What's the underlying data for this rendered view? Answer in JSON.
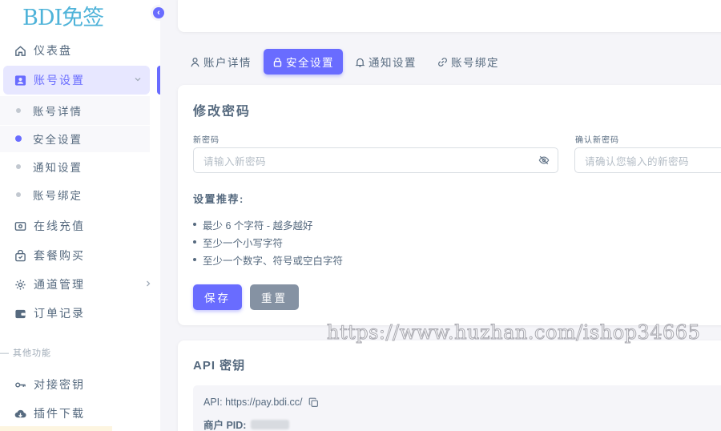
{
  "logo": "BDI免签",
  "sidebar": {
    "items": [
      {
        "label": "仪表盘",
        "icon": "home-icon"
      },
      {
        "label": "账号设置",
        "icon": "account-icon"
      },
      {
        "label": "在线充值",
        "icon": "recharge-icon"
      },
      {
        "label": "套餐购买",
        "icon": "package-icon"
      },
      {
        "label": "通道管理",
        "icon": "settings-icon"
      },
      {
        "label": "订单记录",
        "icon": "wallet-icon"
      }
    ],
    "sub_items": [
      "账号详情",
      "安全设置",
      "通知设置",
      "账号绑定"
    ],
    "section_header": "— 其他功能",
    "other_items": [
      {
        "label": "对接密钥",
        "icon": "key-icon"
      },
      {
        "label": "插件下载",
        "icon": "cloud-download-icon"
      }
    ]
  },
  "tabs": [
    {
      "label": "账户详情",
      "icon": "user-icon"
    },
    {
      "label": "安全设置",
      "icon": "lock-icon"
    },
    {
      "label": "通知设置",
      "icon": "bell-icon"
    },
    {
      "label": "账号绑定",
      "icon": "link-icon"
    }
  ],
  "password_card": {
    "title": "修改密码",
    "new_password_label": "新密码",
    "new_password_placeholder": "请输入新密码",
    "confirm_label": "确认新密码",
    "confirm_placeholder": "请确认您输入的新密码",
    "requirements_title": "设置推荐:",
    "requirements": [
      "最少 6 个字符 - 越多越好",
      "至少一个小写字符",
      "至少一个数字、符号或空白字符"
    ],
    "save_label": "保存",
    "reset_label": "重置"
  },
  "api_card": {
    "title": "API 密钥",
    "api_label": "API:",
    "api_value": "https://pay.bdi.cc/",
    "pid_label": "商户 PID:"
  },
  "watermark": "https://www.huzhan.com/ishop34665",
  "colors": {
    "primary": "#696cff",
    "secondary": "#8592a3",
    "text": "#566a7f",
    "background": "#f5f5f9"
  }
}
